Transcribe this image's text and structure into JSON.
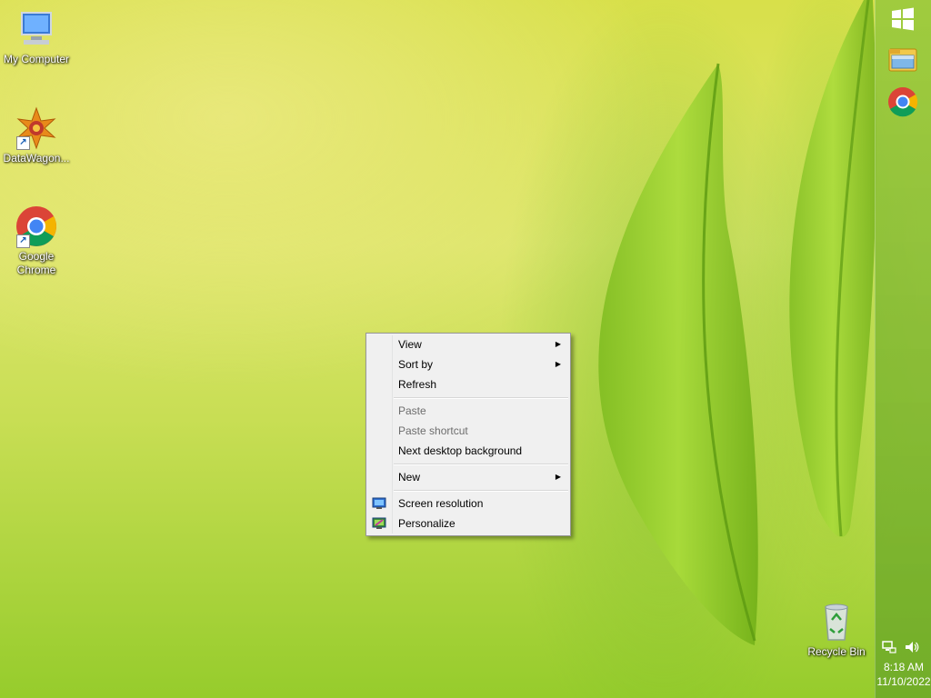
{
  "desktop": {
    "icons": [
      {
        "label": "My Computer"
      },
      {
        "label": "DataWagon..."
      },
      {
        "label": "Google Chrome"
      },
      {
        "label": "Recycle Bin"
      }
    ]
  },
  "context_menu": {
    "items": [
      {
        "label": "View",
        "submenu": true,
        "enabled": true
      },
      {
        "label": "Sort by",
        "submenu": true,
        "enabled": true
      },
      {
        "label": "Refresh",
        "enabled": true
      },
      {
        "label": "Paste",
        "enabled": false
      },
      {
        "label": "Paste shortcut",
        "enabled": false
      },
      {
        "label": "Next desktop background",
        "enabled": true
      },
      {
        "label": "New",
        "submenu": true,
        "enabled": true
      },
      {
        "label": "Screen resolution",
        "icon": "monitor-icon",
        "enabled": true
      },
      {
        "label": "Personalize",
        "icon": "personalize-icon",
        "enabled": true
      }
    ]
  },
  "taskbar": {
    "buttons": [
      {
        "name": "start",
        "icon": "windows-logo-icon"
      },
      {
        "name": "file-explorer",
        "icon": "folder-icon"
      },
      {
        "name": "chrome",
        "icon": "chrome-icon"
      }
    ],
    "tray": {
      "icons": [
        "network-icon",
        "speaker-icon"
      ],
      "time": "8:18 AM",
      "date": "11/10/2022"
    }
  },
  "colors": {
    "taskbar": "#8cc43c",
    "menu_bg": "#f0f0f0",
    "disabled_text": "#6d6d6d"
  }
}
